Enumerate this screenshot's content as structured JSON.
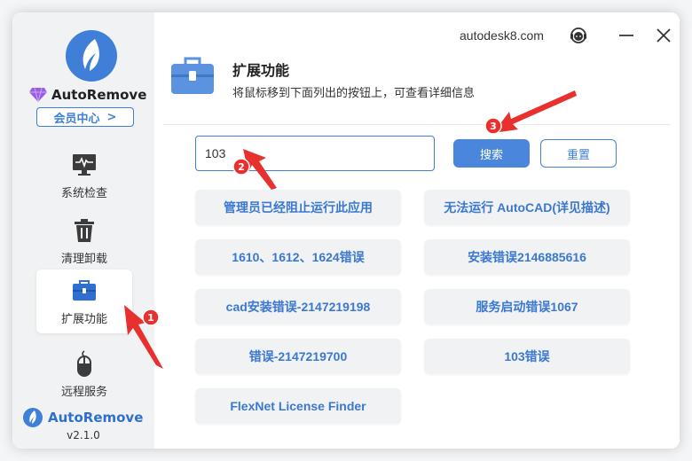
{
  "sidebar": {
    "brand_name": "AutoRemove",
    "member_center": "会员中心",
    "member_arrow": ">",
    "items": [
      {
        "label": "系统检查",
        "icon": "monitor-pulse-icon"
      },
      {
        "label": "清理卸载",
        "icon": "trash-icon"
      },
      {
        "label": "扩展功能",
        "icon": "toolbox-icon",
        "active": true
      },
      {
        "label": "远程服务",
        "icon": "mouse-icon"
      }
    ],
    "bottom_brand": "AutoRemove",
    "version": "v2.1.0"
  },
  "topbar": {
    "site": "autodesk8.com",
    "icons": [
      "support-headset-icon",
      "minimize-icon",
      "close-icon"
    ]
  },
  "header": {
    "title": "扩展功能",
    "subtitle": "将鼠标移到下面列出的按钮上，可查看详细信息"
  },
  "search": {
    "value": "103",
    "search_label": "搜索",
    "reset_label": "重置"
  },
  "options": [
    "管理员已经阻止运行此应用",
    "无法运行 AutoCAD(详见描述)",
    "1610、1612、1624错误",
    "安装错误2146885616",
    "cad安装错误-2147219198",
    "服务启动错误1067",
    "错误-2147219700",
    "103错误",
    "FlexNet License Finder"
  ],
  "annotations": [
    "1",
    "2",
    "3"
  ],
  "colors": {
    "accent": "#3f7fd8",
    "annotation_red": "#e8312f",
    "option_text": "#3b78d1",
    "sidebar_bg": "#f1f2f4"
  }
}
